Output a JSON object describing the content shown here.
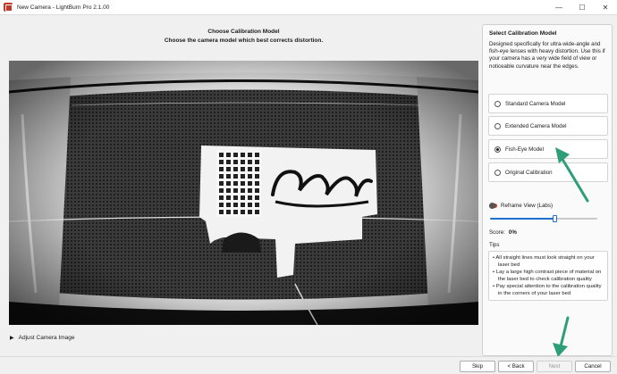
{
  "window": {
    "title": "New Camera - LightBurn Pro 2.1.00",
    "controls": {
      "minimize": "—",
      "maximize": "☐",
      "close": "✕"
    }
  },
  "main": {
    "heading": "Choose Calibration Model",
    "subheading": "Choose the camera model which best corrects distortion.",
    "adjust_label": "Adjust Camera Image"
  },
  "panel": {
    "title": "Select Calibration Model",
    "description": "Designed specifically for ultra-wide-angle and fish-eye lenses with heavy distortion. Use this if your camera has a very wide field of view or noticeable curvature near the edges.",
    "models": [
      {
        "label": "Standard Camera Model",
        "selected": false
      },
      {
        "label": "Extended Camera Model",
        "selected": false
      },
      {
        "label": "Fish-Eye Model",
        "selected": true
      },
      {
        "label": "Original Calibration",
        "selected": false
      }
    ],
    "reframe_label": "Reframe View (Labs)",
    "reframe_value": 0.6,
    "score_label": "Score:",
    "score_value": "0%",
    "tips_label": "Tips",
    "tips": [
      "• All straight lines must look straight on your laser bed",
      "• Lay a large high contrast piece of material on the laser bed to check calibration quality",
      "• Pay special attention to the calibration quality in the corners of your laser bed"
    ]
  },
  "footer": {
    "skip": "Skip",
    "back": "< Back",
    "next": "Next",
    "cancel": "Cancel"
  },
  "colors": {
    "accent": "#1f6fd0",
    "arrow": "#2e9e78",
    "brand": "#c0392b"
  }
}
